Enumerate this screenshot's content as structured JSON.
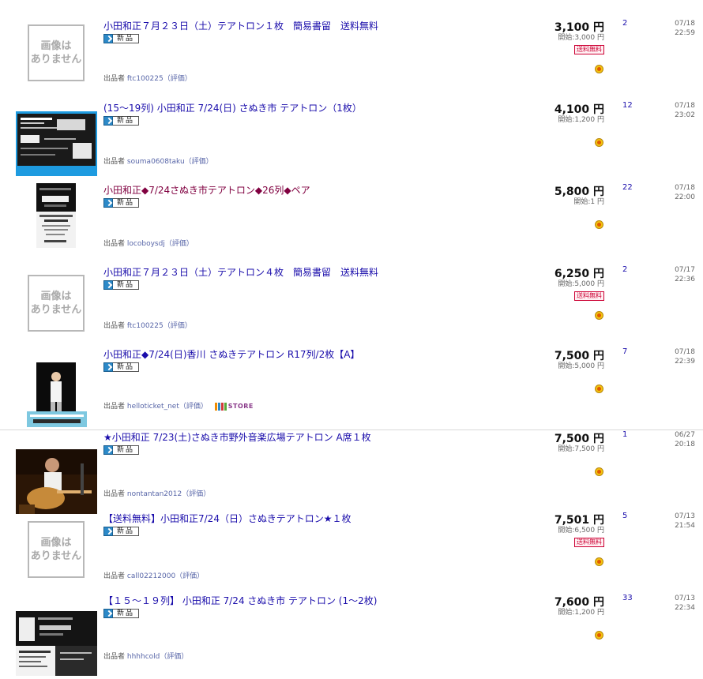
{
  "no_image_text": [
    "画像は",
    "ありません"
  ],
  "new_label": "新品",
  "shipping_label": "送料無料",
  "store_label": "STORE",
  "items": [
    {
      "title": "小田和正７月２３日（土）テアトロン１枚　簡易書留　送料無料",
      "visited": false,
      "seller_prefix": "出品者",
      "seller": "ftc100225",
      "rating": "（評価）",
      "price": "3,100 円",
      "start": "開始:3,000 円",
      "free_shipping": true,
      "bids": "2",
      "date": "07/18",
      "time": "22:59",
      "thumb": "none",
      "store": false
    },
    {
      "title": "(15～19列) 小田和正 7/24(日) さぬき市 テアトロン（1枚）",
      "visited": false,
      "seller_prefix": "出品者",
      "seller": "souma0608taku",
      "rating": "（評価）",
      "price": "4,100 円",
      "start": "開始:1,200 円",
      "free_shipping": false,
      "bids": "12",
      "date": "07/18",
      "time": "23:02",
      "thumb": "ticket-blue",
      "store": false
    },
    {
      "title": "小田和正◆7/24さぬき市テアトロン◆26列◆ペア",
      "visited": true,
      "seller_prefix": "出品者",
      "seller": "locoboysdj",
      "rating": "（評価）",
      "price": "5,800 円",
      "start": "開始:1 円",
      "free_shipping": false,
      "bids": "22",
      "date": "07/18",
      "time": "22:00",
      "thumb": "flyer",
      "store": false
    },
    {
      "title": "小田和正７月２３日（土）テアトロン４枚　簡易書留　送料無料",
      "visited": false,
      "seller_prefix": "出品者",
      "seller": "ftc100225",
      "rating": "（評価）",
      "price": "6,250 円",
      "start": "開始:5,000 円",
      "free_shipping": true,
      "bids": "2",
      "date": "07/17",
      "time": "22:36",
      "thumb": "none",
      "store": false
    },
    {
      "title": "小田和正◆7/24(日)香川 さぬきテアトロン R17列/2枚【A】",
      "visited": false,
      "seller_prefix": "出品者",
      "seller": "helloticket_net",
      "rating": "（評価）",
      "price": "7,500 円",
      "start": "開始:5,000 円",
      "free_shipping": false,
      "bids": "7",
      "date": "07/18",
      "time": "22:39",
      "thumb": "poster",
      "store": true
    },
    {
      "title": "★小田和正 7/23(土)さぬき市野外音楽広場テアトロン A席１枚",
      "visited": false,
      "seller_prefix": "出品者",
      "seller": "nontantan2012",
      "rating": "（評価）",
      "price": "7,500 円",
      "start": "開始:7,500 円",
      "free_shipping": false,
      "bids": "1",
      "date": "06/27",
      "time": "20:18",
      "thumb": "photo",
      "store": false
    },
    {
      "title": "【送料無料】小田和正7/24（日）さぬきテアトロン★１枚",
      "visited": false,
      "seller_prefix": "出品者",
      "seller": "call02212000",
      "rating": "（評価）",
      "price": "7,501 円",
      "start": "開始:6,500 円",
      "free_shipping": true,
      "bids": "5",
      "date": "07/13",
      "time": "21:54",
      "thumb": "none",
      "store": false
    },
    {
      "title": "【１５～１９列】 小田和正 7/24 さぬき市 テアトロン (1～2枚)",
      "visited": false,
      "seller_prefix": "出品者",
      "seller": "hhhhcold",
      "rating": "（評価）",
      "price": "7,600 円",
      "start": "開始:1,200 円",
      "free_shipping": false,
      "bids": "33",
      "date": "07/13",
      "time": "22:34",
      "thumb": "ticket-mixed",
      "store": false
    }
  ]
}
